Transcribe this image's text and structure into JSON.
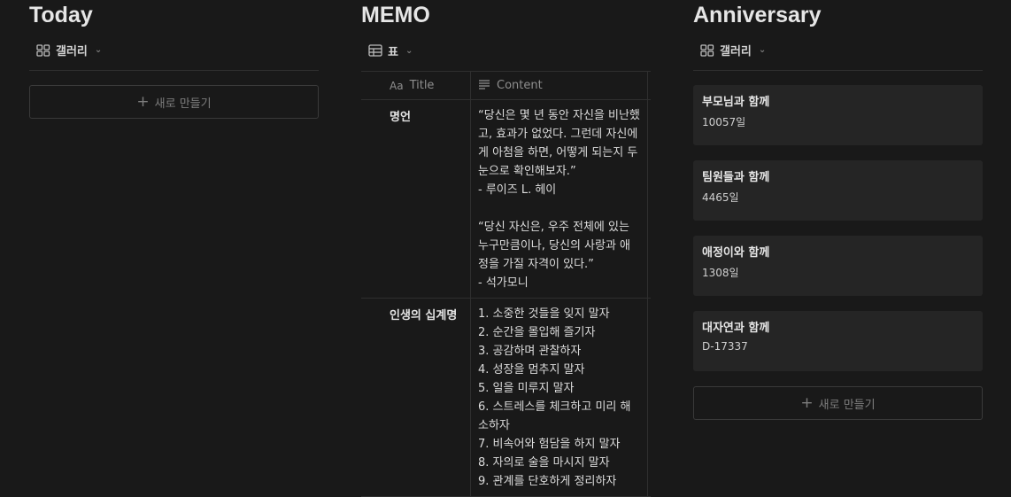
{
  "today": {
    "title": "Today",
    "view": {
      "icon": "gallery-icon",
      "label": "갤러리"
    },
    "new_label": "새로 만들기"
  },
  "memo": {
    "title": "MEMO",
    "view": {
      "icon": "table-icon",
      "label": "표"
    },
    "columns": [
      {
        "icon": "text-aa-icon",
        "label": "Title"
      },
      {
        "icon": "lines-icon",
        "label": "Content"
      }
    ],
    "rows": [
      {
        "title": "명언",
        "content": "“당신은 몇 년 동안 자신을 비난했고, 효과가 없었다. 그런데 자신에게 아첨을 하면, 어떻게 되는지 두 눈으로 확인해보자.”\n- 루이즈 L. 헤이\n\n“당신 자신은, 우주 전체에 있는 누구만큼이나, 당신의 사랑과 애정을 가질 자격이 있다.”\n- 석가모니"
      },
      {
        "title": "인생의 십계명",
        "content": "1. 소중한 것들을 잊지 말자\n2. 순간을 몰입해 즐기자\n3. 공감하며 관찰하자\n4. 성장을 멈추지 말자\n5. 일을 미루지 말자\n6. 스트레스를 체크하고 미리 해소하자\n7. 비속어와 험담을 하지 말자\n8. 자의로 술을 마시지 말자\n9. 관계를 단호하게 정리하자"
      }
    ]
  },
  "anniversary": {
    "title": "Anniversary",
    "view": {
      "icon": "gallery-icon",
      "label": "갤러리"
    },
    "cards": [
      {
        "title": "부모님과 함께",
        "value": "10057일"
      },
      {
        "title": "팀원들과 함께",
        "value": "4465일"
      },
      {
        "title": "애정이와 함께",
        "value": "1308일"
      },
      {
        "title": "대자연과 함께",
        "value": "D-17337"
      }
    ],
    "new_label": "새로 만들기"
  },
  "colors": {
    "background": "#191919",
    "card": "#252525",
    "border": "#2f2f2f"
  }
}
